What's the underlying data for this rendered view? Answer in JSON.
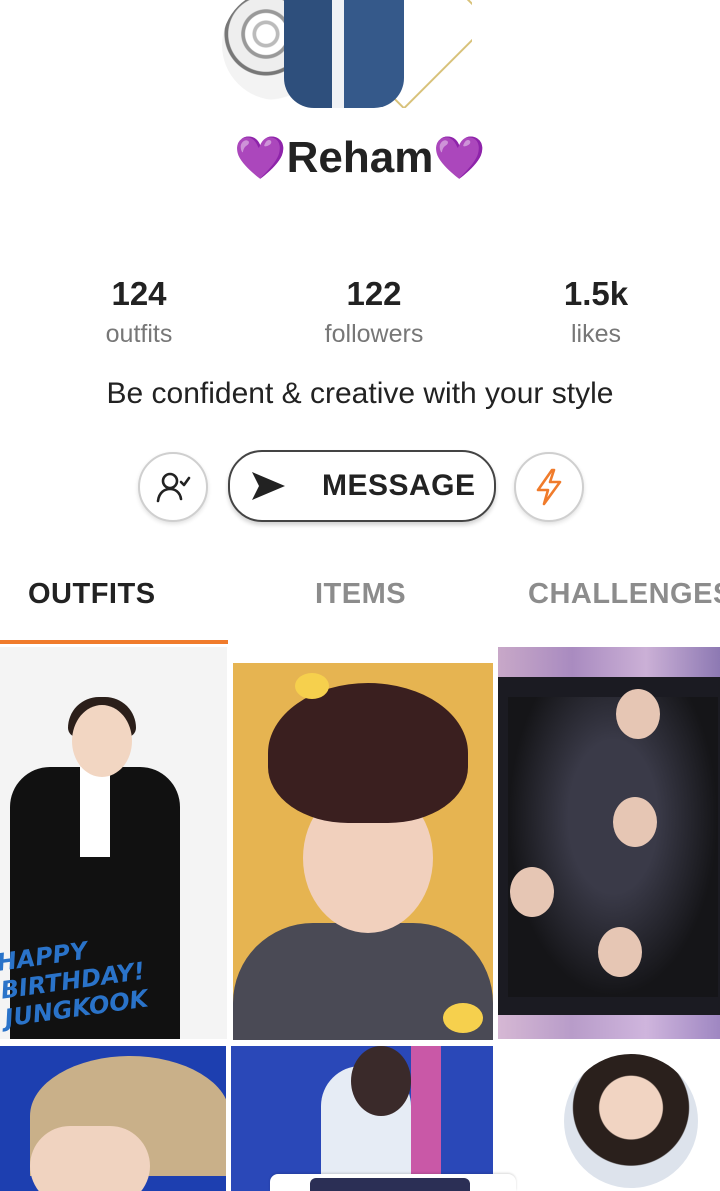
{
  "profile": {
    "name": "Reham",
    "heart_left": "💜",
    "heart_right": "💜",
    "bio": "Be confident & creative with your style"
  },
  "stats": [
    {
      "value": "124",
      "label": "outfits"
    },
    {
      "value": "122",
      "label": "followers"
    },
    {
      "value": "1.5k",
      "label": "likes"
    }
  ],
  "actions": {
    "message_label": "MESSAGE",
    "follow_icon": "user-check-icon",
    "boost_icon": "lightning-icon",
    "accent": "#f07b2b"
  },
  "tabs": [
    {
      "label": "OUTFITS",
      "active": true
    },
    {
      "label": "ITEMS",
      "active": false
    },
    {
      "label": "CHALLENGES",
      "active": false
    }
  ],
  "grid": {
    "tile1_caption": "HAPPY BIRTHDAY! JUNGKOOK"
  }
}
